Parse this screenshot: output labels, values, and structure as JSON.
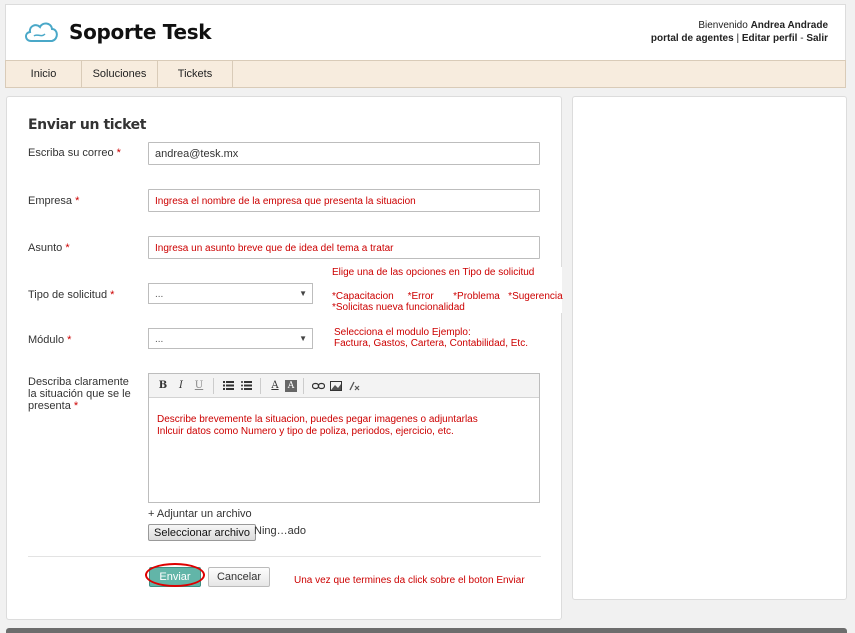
{
  "header": {
    "app_title": "Soporte Tesk",
    "welcome_prefix": "Bienvenido",
    "user_name": "Andrea Andrade",
    "links": [
      "portal de agentes",
      "Editar perfil",
      "Salir"
    ]
  },
  "nav": {
    "items": [
      "Inicio",
      "Soluciones",
      "Tickets"
    ]
  },
  "form": {
    "title": "Enviar un ticket",
    "required_mark": "*",
    "email": {
      "label": "Escriba su correo",
      "value": "andrea@tesk.mx"
    },
    "empresa": {
      "label": "Empresa",
      "value": "Ingresa el nombre de la empresa que presenta la situacion"
    },
    "asunto": {
      "label": "Asunto",
      "value": "Ingresa un asunto breve que de idea del tema a tratar"
    },
    "tipo": {
      "label": "Tipo de solicitud",
      "selected": "...",
      "note_line1": "Elige una de las opciones en Tipo de solicitud",
      "note_line2": "*Capacitacion     *Error       *Problema   *Sugerencia",
      "note_line3": "*Solicitas nueva funcionalidad"
    },
    "modulo": {
      "label": "Módulo",
      "selected": "...",
      "note_line1": "Selecciona el modulo Ejemplo:",
      "note_line2": "Factura, Gastos, Cartera, Contabilidad, Etc."
    },
    "descripcion": {
      "label_line1": "Describa claramente",
      "label_line2": "la situación que se le",
      "label_line3": "presenta",
      "text_line1": "Describe brevemente la situacion, puedes pegar imagenes o adjuntarlas",
      "text_line2": "Inlcuir datos como Numero y tipo de poliza, periodos, ejercicio, etc."
    },
    "attach": {
      "link": "+ Adjuntar un archivo",
      "button": "Seleccionar archivo",
      "status": "Ning…ado"
    },
    "submit_label": "Enviar",
    "cancel_label": "Cancelar",
    "submit_note": "Una vez que termines da click sobre el boton  Enviar"
  },
  "toolbar": {
    "bold": "B",
    "italic": "I",
    "underline": "U",
    "font_color": "A",
    "bg_color": "A"
  },
  "colors": {
    "accent": "#62b5a8",
    "note_red": "#cc0000",
    "nav_bg": "#f7ecde"
  }
}
